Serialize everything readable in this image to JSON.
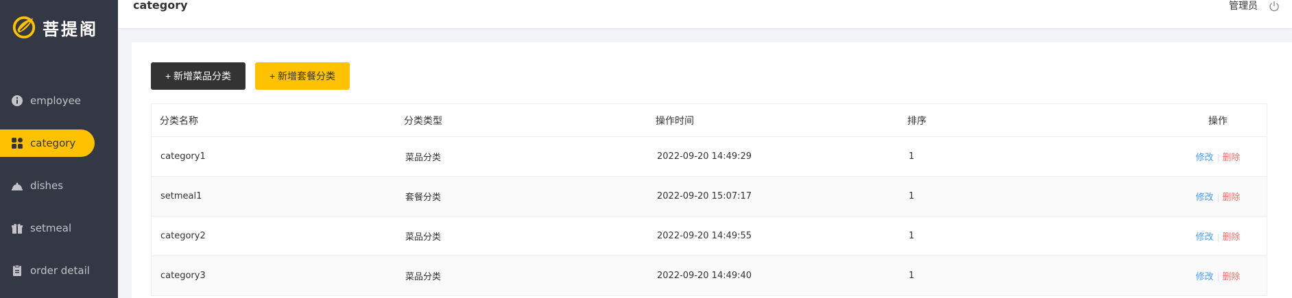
{
  "app": {
    "logo_text": "菩提阁"
  },
  "sidebar": {
    "items": [
      {
        "label": "employee",
        "icon": "info-circle-icon",
        "active": false
      },
      {
        "label": "category",
        "icon": "grid-icon",
        "active": true
      },
      {
        "label": "dishes",
        "icon": "cloche-icon",
        "active": false
      },
      {
        "label": "setmeal",
        "icon": "gift-icon",
        "active": false
      },
      {
        "label": "order detail",
        "icon": "clipboard-icon",
        "active": false
      }
    ]
  },
  "header": {
    "title": "category",
    "user": "管理员",
    "logout_icon": "power-icon"
  },
  "toolbar": {
    "add_dish_category": "+ 新增菜品分类",
    "add_setmeal_category": "+ 新增套餐分类"
  },
  "table": {
    "columns": [
      "分类名称",
      "分类类型",
      "操作时间",
      "排序",
      "操作"
    ],
    "rows": [
      {
        "name": "category1",
        "type": "菜品分类",
        "time": "2022-09-20 14:49:29",
        "sort": "1"
      },
      {
        "name": "setmeal1",
        "type": "套餐分类",
        "time": "2022-09-20 15:07:17",
        "sort": "1"
      },
      {
        "name": "category2",
        "type": "菜品分类",
        "time": "2022-09-20 14:49:55",
        "sort": "1"
      },
      {
        "name": "category3",
        "type": "菜品分类",
        "time": "2022-09-20 14:49:40",
        "sort": "1"
      }
    ],
    "actions": {
      "edit": "修改",
      "delete": "删除"
    }
  },
  "colors": {
    "accent": "#ffc200",
    "sidebar_bg": "#343744",
    "edit_link": "#419efd",
    "delete_link": "#f56c6c"
  }
}
